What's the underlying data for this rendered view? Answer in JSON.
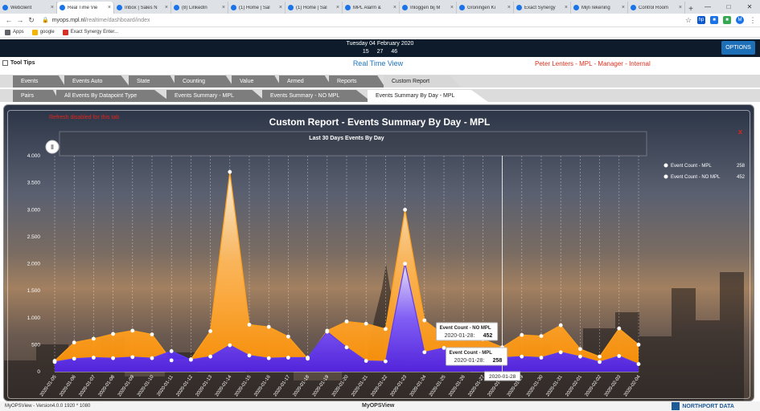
{
  "browser": {
    "tabs": [
      {
        "label": "Webclient",
        "active": false
      },
      {
        "label": "Real Time Vie",
        "active": true
      },
      {
        "label": "Inbox | Sales N",
        "active": false
      },
      {
        "label": "(8) LinkedIn",
        "active": false
      },
      {
        "label": "(1) Home | Sal",
        "active": false
      },
      {
        "label": "(1) Home | Sal",
        "active": false
      },
      {
        "label": "MPL Alarm &",
        "active": false
      },
      {
        "label": "Inloggen bij M",
        "active": false
      },
      {
        "label": "Groningen Ki",
        "active": false
      },
      {
        "label": "Exact Synergy",
        "active": false
      },
      {
        "label": "Mijn rekening",
        "active": false
      },
      {
        "label": "Control Room",
        "active": false
      }
    ],
    "url_host": "myops.mpl.nl",
    "url_path": "/realtime/dashboard/index",
    "bookmarks": [
      "Apps",
      "google",
      "Exact Synergy Enter..."
    ],
    "profile_initial": "M"
  },
  "app": {
    "date": "Tuesday 04 February 2020",
    "time": "15  27  46",
    "options_label": "OPTIONS",
    "tooltips_label": "Tool Tips",
    "view_name": "Real Time View",
    "user_info": "Peter Lenters - MPL - Manager - Internal",
    "tabs_row1": [
      "Events",
      "Events Auto",
      "State",
      "Counting",
      "Value",
      "Armed",
      "Reports",
      "Custom Report"
    ],
    "tabs_row1_active": 7,
    "tabs_row2": [
      "Pairs",
      "All Events By Datapoint Type",
      "Events Summary - MPL",
      "Events Summary - NO MPL",
      "Events Summary By Day - MPL"
    ],
    "tabs_row2_active": 4,
    "panel_error": "Refresh disabled for this tab",
    "panel_title": "Custom Report - Events Summary By Day - MPL",
    "close_label": "x"
  },
  "chart_data": {
    "type": "area",
    "title": "Last 30 Days Events By Day",
    "ylim": [
      0,
      4000
    ],
    "yticks": [
      "0",
      "500",
      "1.000",
      "1.500",
      "2.000",
      "2.500",
      "3.000",
      "3.500",
      "4.000"
    ],
    "categories": [
      "2020-01-05",
      "2020-01-06",
      "2020-01-07",
      "2020-01-08",
      "2020-01-09",
      "2020-01-10",
      "2020-01-11",
      "2020-01-12",
      "2020-01-13",
      "2020-01-14",
      "2020-01-15",
      "2020-01-16",
      "2020-01-17",
      "2020-01-18",
      "2020-01-19",
      "2020-01-20",
      "2020-01-21",
      "2020-01-22",
      "2020-01-23",
      "2020-01-24",
      "2020-01-25",
      "2020-01-26",
      "2020-01-27",
      "2020-01-28",
      "2020-01-29",
      "2020-01-30",
      "2020-01-31",
      "2020-02-01",
      "2020-02-02",
      "2020-02-03",
      "2020-02-04"
    ],
    "series": [
      {
        "name": "Event Count - MPL",
        "total": "258",
        "color": "#5b3cf0",
        "values": [
          180,
          240,
          260,
          250,
          270,
          250,
          380,
          220,
          280,
          490,
          300,
          250,
          260,
          260,
          740,
          450,
          200,
          190,
          2000,
          360,
          440,
          300,
          220,
          258,
          280,
          260,
          360,
          280,
          180,
          290,
          140
        ]
      },
      {
        "name": "Event Count - NO MPL",
        "total": "452",
        "color": "#ff9f1a",
        "values": [
          200,
          540,
          610,
          700,
          760,
          690,
          210,
          230,
          750,
          3700,
          870,
          830,
          650,
          240,
          760,
          930,
          890,
          790,
          3000,
          950,
          680,
          760,
          600,
          452,
          680,
          660,
          860,
          420,
          280,
          800,
          500
        ]
      }
    ],
    "tooltips": [
      {
        "title": "Event Count - NO MPL",
        "date": "2020-01-28:",
        "value": "452"
      },
      {
        "title": "Event Count - MPL",
        "date": "2020-01-28:",
        "value": "258"
      }
    ],
    "crosshair_label": "2020-01-28",
    "legend_position": "top-right",
    "grid": true
  },
  "footer": {
    "version": "MyOPSView - Version4.0.0  1920 * 1080",
    "app_name": "MyOPSView",
    "brand": "NORTHPORT DATA"
  }
}
